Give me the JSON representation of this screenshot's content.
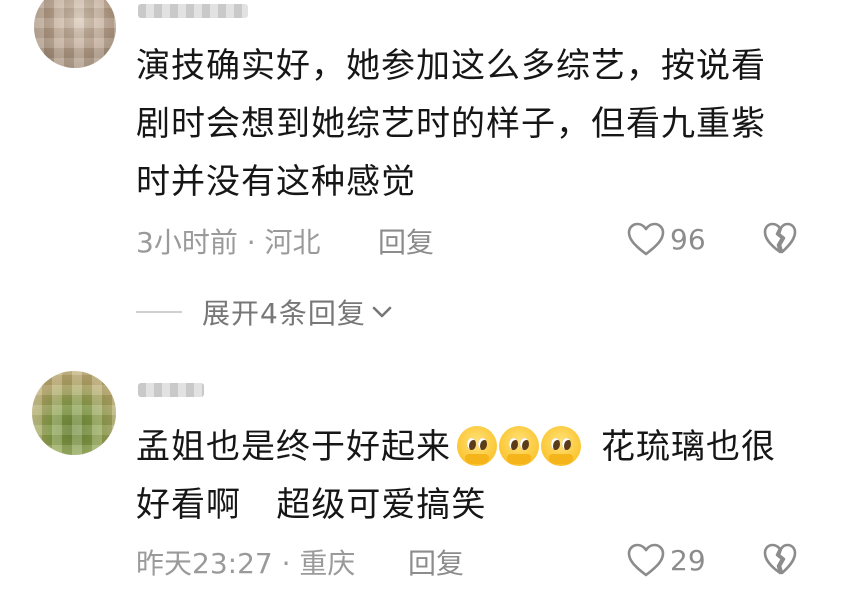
{
  "comments": [
    {
      "lines": [
        "演技确实好，她参加这么多综艺，按说看",
        "剧时会想到她综艺时的样子，但看九重紫",
        "时并没有这种感觉"
      ],
      "time_location": "3小时前 · 河北",
      "reply_label": "回复",
      "like_count": "96",
      "expand_label": "展开4条回复"
    },
    {
      "line1_before_emoji": "孟姐也是终于好起来",
      "emoji_names": [
        "pleading-face-icon",
        "pleading-face-icon",
        "pleading-face-icon"
      ],
      "line1_after_emoji": "花琉璃也很",
      "line2": "好看啊   超级可爱搞笑",
      "time_location": "昨天23:27 · 重庆",
      "reply_label": "回复",
      "like_count": "29"
    }
  ],
  "colors": {
    "text": "#161616",
    "meta": "#9a9a9a",
    "icon": "#8c8c8c",
    "background": "#ffffff"
  }
}
